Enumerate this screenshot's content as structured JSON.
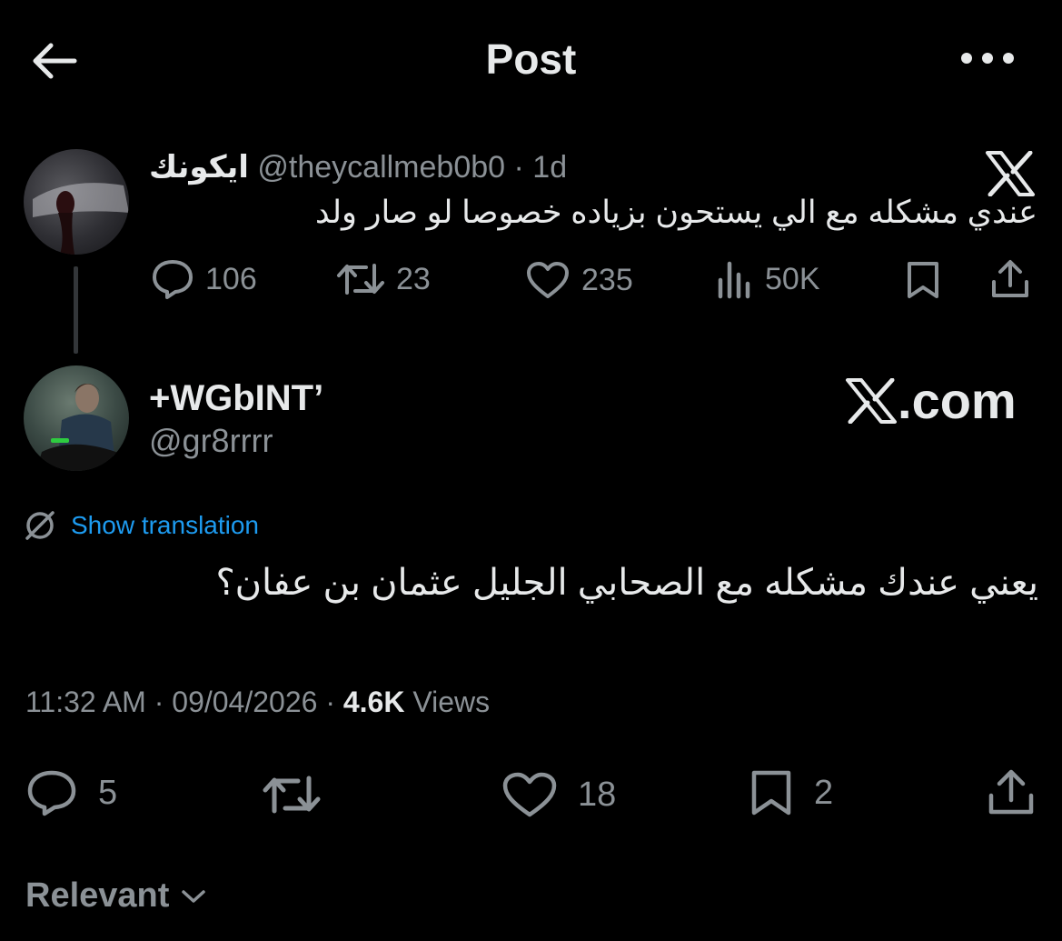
{
  "header": {
    "title": "Post"
  },
  "quoted": {
    "name": "ايكونك",
    "handle": "@theycallmeb0b0",
    "time": "· 1d",
    "text": "عندي مشكله مع الي يستحون بزياده خصوصا لو صار ولد",
    "replies": "106",
    "reposts": "23",
    "likes": "235",
    "views": "50K"
  },
  "post": {
    "name": "+WGbINT’",
    "handle": "@gr8rrrr",
    "watermark": "com",
    "translate_label": "Show translation",
    "text": "يعني عندك مشكله مع الصحابي الجليل عثمان بن عفان؟",
    "time": "11:32 AM",
    "date": "09/04/2026",
    "views_count": "4.6K",
    "views_label": "Views",
    "replies": "5",
    "likes": "18",
    "bookmarks": "2"
  },
  "sort": {
    "label": "Relevant"
  },
  "colors": {
    "background": "#000000",
    "text": "#e7e9ea",
    "muted": "#8b9196",
    "accent": "#1d9bf0"
  },
  "icons": [
    "back-arrow-icon",
    "more-icon",
    "x-logo-icon",
    "reply-icon",
    "repost-icon",
    "like-icon",
    "views-icon",
    "bookmark-icon",
    "share-icon",
    "translate-icon",
    "chevron-down-icon"
  ]
}
